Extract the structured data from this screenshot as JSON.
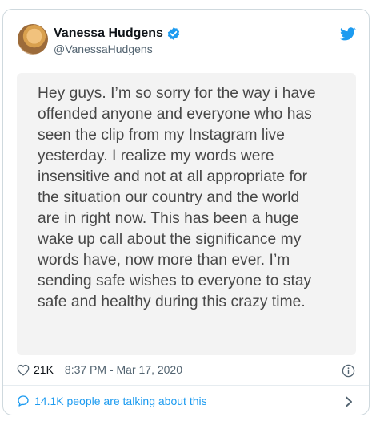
{
  "tweet": {
    "author_name": "Vanessa Hudgens",
    "handle": "@VanessaHudgens",
    "note_lines": [
      "Hey guys. I’m so sorry for the way i have",
      "offended anyone and everyone who has",
      "seen the clip from my Instagram live",
      "yesterday. I realize my words were",
      "insensitive and not at all appropriate for",
      "the situation our country and the world",
      "are in right now. This has been a huge",
      "wake up call about the significance my",
      "words have, now more than ever. I’m",
      "sending safe wishes to everyone to stay",
      "safe and healthy during this crazy time."
    ],
    "likes": "21K",
    "timestamp": "8:37 PM - Mar 17, 2020",
    "talking": "14.1K people are talking about this"
  },
  "icons": {
    "verified": "verified-badge-icon",
    "bird": "twitter-bird-icon",
    "heart": "heart-icon",
    "info": "info-icon",
    "bubble": "speech-bubble-icon",
    "chevron": "chevron-right-icon"
  },
  "colors": {
    "accent": "#1d9bf0",
    "text": "#0f1419",
    "muted": "#536471",
    "note_bg": "#f3f3f3"
  }
}
